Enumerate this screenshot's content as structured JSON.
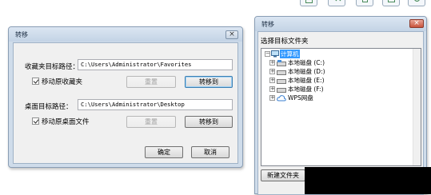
{
  "dialog1": {
    "title": "转移",
    "favorites_label": "收藏夹目标路径：",
    "favorites_path": "C:\\Users\\Administrator\\Favorites",
    "favorites_move_checkbox": "移动原收藏夹",
    "reset_label": "重置",
    "transfer_label": "转移到",
    "desktop_label": "桌面目标路径：",
    "desktop_path": "C:\\Users\\Administrator\\Desktop",
    "desktop_move_checkbox": "移动原桌面文件",
    "ok_label": "确定",
    "cancel_label": "取消"
  },
  "dialog2": {
    "title": "转移",
    "prompt": "选择目标文件夹",
    "tree": {
      "root": "计算机",
      "items": [
        "本地磁盘 (C:)",
        "本地磁盘 (D:)",
        "本地磁盘 (E:)",
        "本地磁盘 (F:)",
        "WPS网盘"
      ]
    },
    "new_folder_label": "新建文件夹"
  }
}
